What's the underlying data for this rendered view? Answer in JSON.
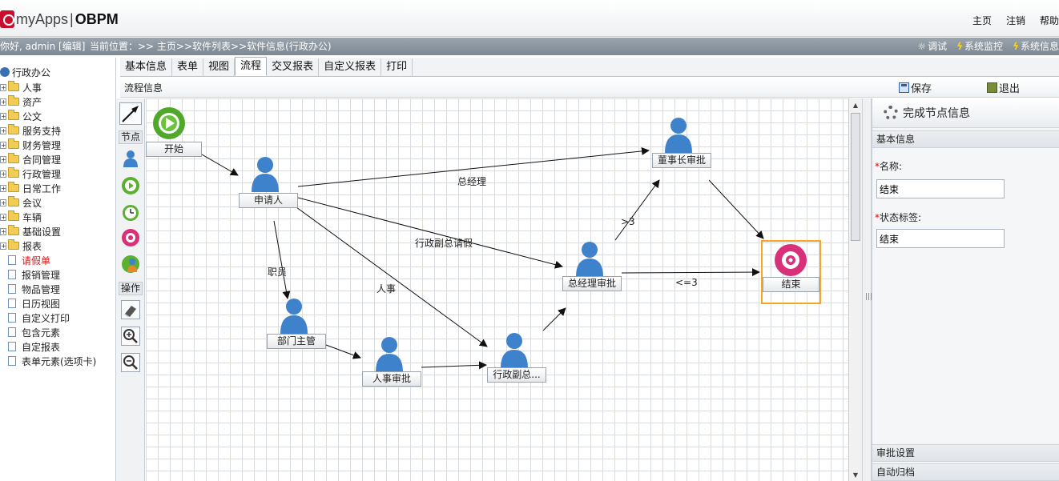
{
  "app": {
    "brand": "myApps",
    "brand_sub": "OBPM"
  },
  "topnav": [
    "主页",
    "注销",
    "帮助"
  ],
  "infobar": {
    "greeting": "你好, admin [编辑]",
    "location": "当前位置：>> 主页>>软件列表>>软件信息(行政办公)",
    "tools": [
      "调试",
      "系统监控",
      "系统信息"
    ]
  },
  "tree": {
    "root": "行政办公",
    "folders": [
      "人事",
      "资产",
      "公文",
      "服务支持",
      "财务管理",
      "合同管理",
      "行政管理",
      "日常工作",
      "会议",
      "车辆",
      "基础设置",
      "报表"
    ],
    "docs": [
      "请假单",
      "报销管理",
      "物品管理",
      "日历视图",
      "自定义打印",
      "包含元素",
      "自定报表",
      "表单元素(选项卡)"
    ],
    "active_doc": "请假单"
  },
  "tabs": [
    "基本信息",
    "表单",
    "视图",
    "流程",
    "交叉报表",
    "自定义报表",
    "打印"
  ],
  "active_tab": "流程",
  "subheader": {
    "title": "流程信息",
    "save": "保存",
    "exit": "退出"
  },
  "palette": {
    "nodes_label": "节点",
    "ops_label": "操作"
  },
  "flow": {
    "nodes": {
      "start": "开始",
      "applicant": "申请人",
      "chairman": "董事长审批",
      "gm": "总经理审批",
      "end": "结束",
      "dept": "部门主管",
      "hr": "人事审批",
      "admin_vp": "行政副总..."
    },
    "edges": {
      "gm_label": "总经理",
      "admin_label": "行政副总请假",
      "staff_label": "职员",
      "hr_label": "人事",
      "gt3": ">3",
      "le3": "<=3"
    }
  },
  "panel": {
    "title": "完成节点信息",
    "basic": "基本信息",
    "name_label": "名称:",
    "name_value": "结束",
    "status_label": "状态标签:",
    "status_value": "结束",
    "approval": "审批设置",
    "archive": "自动归档"
  },
  "colors": {
    "accent_orange": "#f5a623",
    "active_red": "#d21f1f"
  }
}
